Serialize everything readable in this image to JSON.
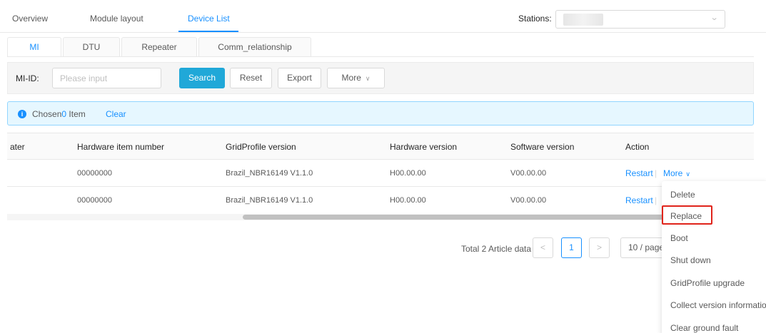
{
  "top_tabs": [
    {
      "label": "Overview"
    },
    {
      "label": "Module layout"
    },
    {
      "label": "Device List",
      "active": true
    }
  ],
  "stations": {
    "label": "Stations:"
  },
  "sub_tabs": [
    {
      "label": "MI",
      "active": true
    },
    {
      "label": "DTU"
    },
    {
      "label": "Repeater"
    },
    {
      "label": "Comm_relationship"
    }
  ],
  "filter": {
    "label": "MI-ID:",
    "placeholder": "Please input",
    "search": "Search",
    "reset": "Reset",
    "export": "Export",
    "more": "More"
  },
  "alert": {
    "prefix": "Chosen",
    "count": "0",
    "suffix": " Item",
    "clear": "Clear"
  },
  "table": {
    "headers": [
      "ater",
      "Hardware item number",
      "GridProfile version",
      "Hardware version",
      "Software version",
      "Action"
    ],
    "rows": [
      {
        "hardware_item_number": "00000000",
        "gridprofile_version": "Brazil_NBR16149 V1.1.0",
        "hardware_version": "H00.00.00",
        "software_version": "V00.00.00"
      },
      {
        "hardware_item_number": "00000000",
        "gridprofile_version": "Brazil_NBR16149 V1.1.0",
        "hardware_version": "H00.00.00",
        "software_version": "V00.00.00"
      }
    ],
    "actions": {
      "restart": "Restart",
      "separator": "|",
      "more": "More"
    }
  },
  "pagination": {
    "total": "Total 2 Article data",
    "prev": "<",
    "current": "1",
    "next": ">",
    "page_size": "10 / page"
  },
  "dropdown": {
    "items": [
      "Delete",
      "Replace",
      "Boot",
      "Shut down",
      "GridProfile upgrade",
      "Collect version information",
      "Clear ground fault"
    ],
    "highlighted": "Replace"
  },
  "colors": {
    "accent": "#1890ff",
    "primary_button": "#20a8d8",
    "alert_bg": "#e6f7ff",
    "highlight_border": "#e0241b"
  }
}
